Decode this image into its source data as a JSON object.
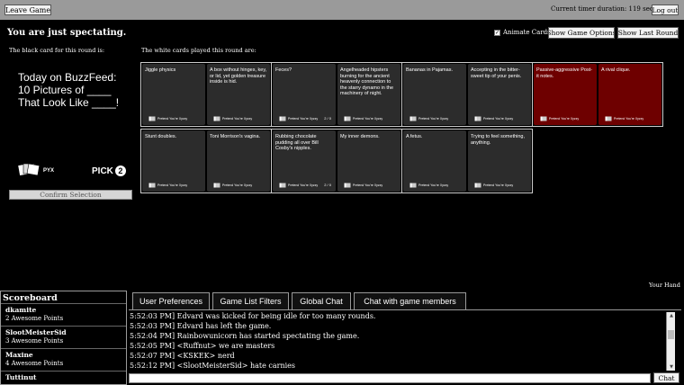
{
  "header": {
    "leave_game": "Leave Game",
    "timer": "Current timer duration: 119 seconds",
    "logout": "Log out"
  },
  "status": {
    "spectating": "You are just spectating.",
    "animate_cards": "Animate Cards",
    "animate_checked": "✓",
    "show_game_options": "Show Game Options",
    "show_last_round": "Show Last Round"
  },
  "labels": {
    "black_card": "The black card for this round is:",
    "white_cards": "The white cards played this round are:",
    "your_hand": "Your Hand"
  },
  "black_card": {
    "line1": "Today on BuzzFeed:",
    "line2": "10 Pictures of ____",
    "line3": "That Look Like ____!",
    "logo_text": "PYX",
    "pick_label": "PICK",
    "pick_count": "2",
    "confirm": "Confirm Selection"
  },
  "white_sets": [
    {
      "cards": [
        {
          "text": "Jiggle physics",
          "brand": "Pretend You're Xyzzy"
        },
        {
          "text": "A box without hinges, key, or lid, yet golden treasure inside is hid.",
          "brand": "Pretend You're Xyzzy"
        }
      ]
    },
    {
      "cards": [
        {
          "text": "Feces?",
          "brand": "Pretend You're Xyzzy",
          "meta": "2 / 0"
        },
        {
          "text": "Angelheaded hipsters burning for the ancient heavenly connection to the starry dynamo in the machinery of night.",
          "brand": "Pretend You're Xyzzy"
        }
      ]
    },
    {
      "cards": [
        {
          "text": "Bananas in Pajamas.",
          "brand": "Pretend You're Xyzzy"
        },
        {
          "text": "Accepting in the bitter-sweet tip of your penis.",
          "brand": "Pretend You're Xyzzy"
        }
      ]
    },
    {
      "cards": [
        {
          "text": "Passive-aggressive Post-it notes.",
          "brand": "Pretend You're Xyzzy"
        },
        {
          "text": "A rival clique.",
          "brand": "Pretend You're Xyzzy"
        }
      ]
    },
    {
      "cards": [
        {
          "text": "Stunt doubles.",
          "brand": "Pretend You're Xyzzy"
        },
        {
          "text": "Toni Morrison's vagina.",
          "brand": "Pretend You're Xyzzy"
        }
      ]
    },
    {
      "cards": [
        {
          "text": "Rubbing chocolate pudding all over Bill Cosby's nipples.",
          "brand": "Pretend You're Xyzzy",
          "meta": "2 / 0"
        },
        {
          "text": "My inner demons.",
          "brand": "Pretend You're Xyzzy"
        }
      ]
    },
    {
      "cards": [
        {
          "text": "A fetus.",
          "brand": "Pretend You're Xyzzy"
        },
        {
          "text": "Trying to feel something, anything.",
          "brand": "Pretend You're Xyzzy"
        }
      ]
    }
  ],
  "scoreboard": {
    "title": "Scoreboard",
    "players": [
      {
        "name": "dkamite",
        "points": "2 Awesome Points"
      },
      {
        "name": "SlootMeisterSid",
        "points": "3 Awesome Points"
      },
      {
        "name": "Maxine",
        "points": "4 Awesome Points"
      },
      {
        "name": "Tuttinut",
        "points": ""
      }
    ]
  },
  "tabs": [
    "User Preferences",
    "Game List Filters",
    "Global Chat",
    "Chat with game members"
  ],
  "chat": {
    "messages": [
      "5:52:03 PM] Edvard was kicked for being idle for too many rounds.",
      "5:52:03 PM] Edvard has left the game.",
      "5:52:04 PM] Rainbowunicorn has started spectating the game.",
      "5:52:05 PM] <Ruffnut> we are masters",
      "5:52:07 PM] <KSKEK> nerd",
      "5:52:12 PM] <SlootMeisterSid> hate carnies"
    ],
    "input_value": "",
    "send": "Chat"
  },
  "colors": {
    "background": "#000000",
    "topbar": "#9a9a9a",
    "white_card": "#2c2c2c",
    "selected_card": "#6e0000"
  }
}
